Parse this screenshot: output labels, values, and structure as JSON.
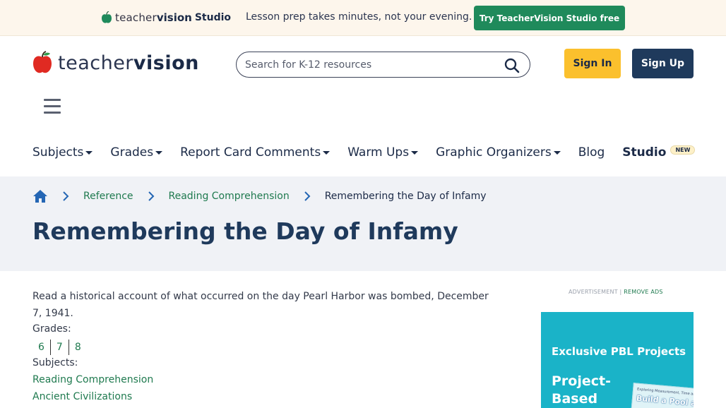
{
  "promo": {
    "logo_word1": "teacher",
    "logo_word2": "vision",
    "logo_word3": "Studio",
    "text": "Lesson prep takes minutes, not your evening.",
    "cta": "Try TeacherVision Studio free"
  },
  "header": {
    "logo_word1": "teacher",
    "logo_word2": "vision",
    "search_placeholder": "Search for K-12 resources",
    "sign_in": "Sign In",
    "sign_up": "Sign Up"
  },
  "nav": {
    "items": [
      {
        "label": "Subjects",
        "dropdown": true
      },
      {
        "label": "Grades",
        "dropdown": true
      },
      {
        "label": "Report Card Comments",
        "dropdown": true
      },
      {
        "label": "Warm Ups",
        "dropdown": true
      },
      {
        "label": "Graphic Organizers",
        "dropdown": true
      },
      {
        "label": "Blog",
        "dropdown": false
      }
    ],
    "studio_label": "Studio",
    "studio_badge": "NEW"
  },
  "breadcrumb": {
    "items": [
      "Reference",
      "Reading Comprehension"
    ],
    "current": "Remembering the Day of Infamy"
  },
  "page": {
    "title": "Remembering the Day of Infamy",
    "description": "Read a historical account of what occurred on the day Pearl Harbor was bombed, December 7, 1941.",
    "grades_label": "Grades:",
    "grades": [
      "6",
      "7",
      "8"
    ],
    "subjects_label": "Subjects:",
    "subjects": [
      "Reading Comprehension",
      "Ancient Civilizations"
    ]
  },
  "ad": {
    "label": "ADVERTISEMENT |",
    "remove": "REMOVE ADS",
    "heading": "Exclusive PBL Projects",
    "title": "Project-Based Learning",
    "card_line1": "Exploring Measurement, Time and Grouping",
    "card_line2": "Build a Pool at"
  },
  "colors": {
    "brand_green": "#1f8a5b",
    "link_green": "#1f7a4f",
    "navy": "#1f3a5c",
    "signin_yellow": "#fbc02d",
    "apple_red": "#e02a22",
    "ad_teal": "#1ab3c8"
  }
}
